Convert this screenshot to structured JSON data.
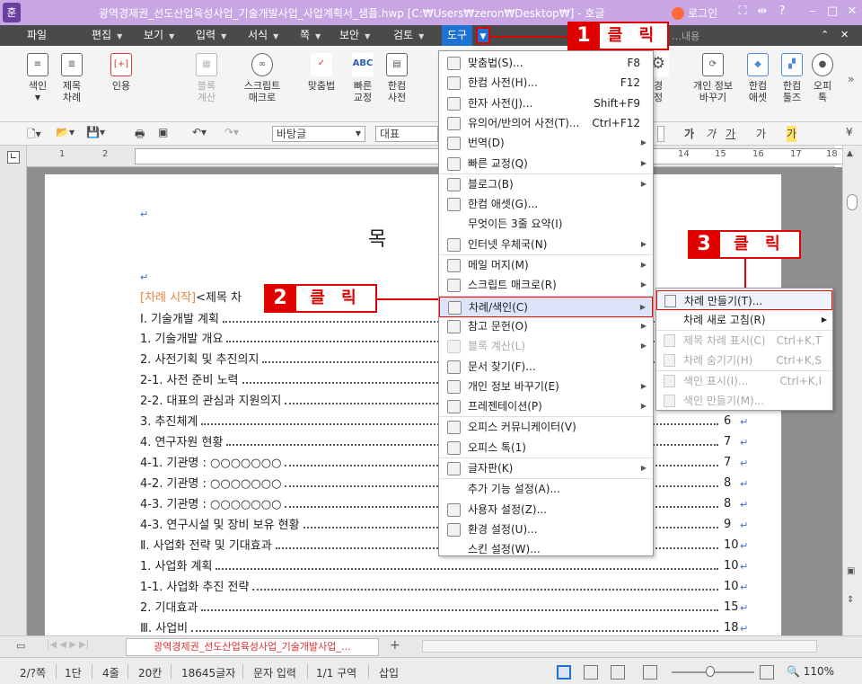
{
  "title_bar": {
    "title": "광역경제권_선도산업육성사업_기술개발사업_사업계획서_샘플.hwp [C:₩Users₩zeron₩Desktop₩] - 호글",
    "app_icon": "훈",
    "login": "로그인"
  },
  "menubar": {
    "items": [
      "파일",
      "편집",
      "보기",
      "입력",
      "서식",
      "쪽",
      "보안",
      "검토",
      "도구"
    ],
    "search_placeholder": "…내용"
  },
  "ribbon": {
    "left": [
      {
        "label1": "색인",
        "label2": "",
        "icon": "index-icon"
      },
      {
        "label1": "제목",
        "label2": "차례",
        "icon": "title-toc-icon"
      },
      {
        "label1": "인용",
        "label2": "",
        "icon": "quote-icon"
      },
      {
        "label1": "블록",
        "label2": "계산",
        "icon": "calc-icon"
      },
      {
        "label1": "스크립트",
        "label2": "매크로",
        "icon": "macro-icon"
      },
      {
        "label1": "맞춤법",
        "label2": "",
        "icon": "spell-icon"
      },
      {
        "label1": "빠른",
        "label2": "교정",
        "icon": "abc-icon"
      },
      {
        "label1": "한컴",
        "label2": "사전",
        "icon": "dict-icon"
      }
    ],
    "right": [
      {
        "label1": "경",
        "label2": "정",
        "icon": "gear-icon"
      },
      {
        "label1": "개인 정보",
        "label2": "바꾸기",
        "icon": "privacy-icon"
      },
      {
        "label1": "한컴",
        "label2": "애셋",
        "icon": "asset-icon"
      },
      {
        "label1": "한컴",
        "label2": "툴즈",
        "icon": "tools-icon"
      },
      {
        "label1": "오피",
        "label2": "톡",
        "icon": "talk-icon"
      }
    ]
  },
  "toolbar2": {
    "style": "바탕글",
    "paragraph": "대표",
    "text_style_buttons": [
      "가",
      "가",
      "가",
      "가",
      "가"
    ]
  },
  "ruler": {
    "numbers": [
      "1",
      "2",
      "14",
      "15",
      "16",
      "17",
      "18"
    ]
  },
  "document": {
    "heading": "목",
    "toc_tag": "[차례 시작]",
    "toc_tag_rest": "<제목 차",
    "lines": [
      {
        "text": "Ⅰ. 기술개발 계획",
        "page": ""
      },
      {
        "text": "1. 기술개발 개요",
        "page": ""
      },
      {
        "text": "2. 사전기획 및 추진의지",
        "page": ""
      },
      {
        "text": "2-1. 사전 준비 노력",
        "page": ""
      },
      {
        "text": "2-2. 대표의 관심과 지원의지",
        "page": ""
      },
      {
        "text": "3. 추진체계",
        "page": "6"
      },
      {
        "text": "4. 연구자원 현황",
        "page": "7"
      },
      {
        "text": "4-1. 기관명 : ○○○○○○○",
        "page": "7"
      },
      {
        "text": "4-2. 기관명 : ○○○○○○○",
        "page": "8"
      },
      {
        "text": "4-3. 기관명 : ○○○○○○○",
        "page": "8"
      },
      {
        "text": "4-3. 연구시설 및 장비 보유 현황",
        "page": "9"
      },
      {
        "text": "Ⅱ. 사업화 전략 및 기대효과",
        "page": "10"
      },
      {
        "text": "1. 사업화 계획",
        "page": "10"
      },
      {
        "text": "1-1. 사업화 추진 전략",
        "page": "10"
      },
      {
        "text": "2. 기대효과",
        "page": "15"
      },
      {
        "text": "Ⅲ. 사업비",
        "page": "18"
      }
    ]
  },
  "dropdown": {
    "items": [
      {
        "label": "맞춤법(S)...",
        "shortcut": "F8",
        "sub": false,
        "dim": false
      },
      {
        "label": "한컴 사전(H)...",
        "shortcut": "F12",
        "sub": false,
        "dim": false
      },
      {
        "label": "한자 사전(J)...",
        "shortcut": "Shift+F9",
        "sub": false,
        "dim": false
      },
      {
        "label": "유의어/반의어 사전(T)...",
        "shortcut": "Ctrl+F12",
        "sub": false,
        "dim": false
      },
      {
        "label": "번역(D)",
        "shortcut": "",
        "sub": true,
        "dim": false
      },
      {
        "label": "빠른 교정(Q)",
        "shortcut": "",
        "sub": true,
        "dim": false
      },
      {
        "label": "블로그(B)",
        "shortcut": "",
        "sub": true,
        "dim": false
      },
      {
        "label": "한컴 애셋(G)...",
        "shortcut": "",
        "sub": false,
        "dim": false
      },
      {
        "label": "무엇이든 3줄 요약(I)",
        "shortcut": "",
        "sub": false,
        "dim": false
      },
      {
        "label": "인터넷 우체국(N)",
        "shortcut": "",
        "sub": true,
        "dim": false
      },
      {
        "label": "메일 머지(M)",
        "shortcut": "",
        "sub": true,
        "dim": false
      },
      {
        "label": "스크립트 매크로(R)",
        "shortcut": "",
        "sub": true,
        "dim": false
      },
      {
        "label": "차례/색인(C)",
        "shortcut": "",
        "sub": true,
        "dim": false
      },
      {
        "label": "참고 문헌(O)",
        "shortcut": "",
        "sub": true,
        "dim": false
      },
      {
        "label": "블록 계산(L)",
        "shortcut": "",
        "sub": true,
        "dim": true
      },
      {
        "label": "문서 찾기(F)...",
        "shortcut": "",
        "sub": false,
        "dim": false
      },
      {
        "label": "개인 정보 바꾸기(E)",
        "shortcut": "",
        "sub": true,
        "dim": false
      },
      {
        "label": "프레젠테이션(P)",
        "shortcut": "",
        "sub": true,
        "dim": false
      },
      {
        "label": "오피스 커뮤니케이터(V)",
        "shortcut": "",
        "sub": false,
        "dim": false
      },
      {
        "label": "오피스 톡(1)",
        "shortcut": "",
        "sub": false,
        "dim": false
      },
      {
        "label": "글자판(K)",
        "shortcut": "",
        "sub": true,
        "dim": false
      },
      {
        "label": "추가 기능 설정(A)...",
        "shortcut": "",
        "sub": false,
        "dim": false
      },
      {
        "label": "사용자 설정(Z)...",
        "shortcut": "",
        "sub": false,
        "dim": false
      },
      {
        "label": "환경 설정(U)...",
        "shortcut": "",
        "sub": false,
        "dim": false
      },
      {
        "label": "스킨 설정(W)...",
        "shortcut": "",
        "sub": false,
        "dim": false
      }
    ]
  },
  "submenu": {
    "items": [
      {
        "label": "차례 만들기(T)...",
        "shortcut": "",
        "dim": false
      },
      {
        "label": "차례 새로 고침(R)",
        "shortcut": "",
        "dim": false
      },
      {
        "label": "제목 차례 표시(C)",
        "shortcut": "Ctrl+K,T",
        "dim": true
      },
      {
        "label": "차례 숨기기(H)",
        "shortcut": "Ctrl+K,S",
        "dim": true
      },
      {
        "label": "색인 표시(I)...",
        "shortcut": "Ctrl+K,I",
        "dim": true
      },
      {
        "label": "색인 만들기(M)...",
        "shortcut": "",
        "dim": true
      }
    ]
  },
  "callouts": [
    {
      "num": "1",
      "text": "클 릭"
    },
    {
      "num": "2",
      "text": "클 릭"
    },
    {
      "num": "3",
      "text": "클 릭"
    }
  ],
  "tabbar": {
    "doc_tab": "광역경제권_선도산업육성사업_기술개발사업_…"
  },
  "statusbar": {
    "page": "2/?쪽",
    "section": "1단",
    "line": "4줄",
    "col": "20칸",
    "chars": "18645글자",
    "mode": "문자 입력",
    "zone": "1/1 구역",
    "insert": "삽입",
    "zoom": "110%"
  },
  "colors": {
    "accent": "#1e73d2",
    "callout_red": "#e00000",
    "title_bg": "#c8a6e4",
    "menubar_bg": "#4a4a4a"
  }
}
